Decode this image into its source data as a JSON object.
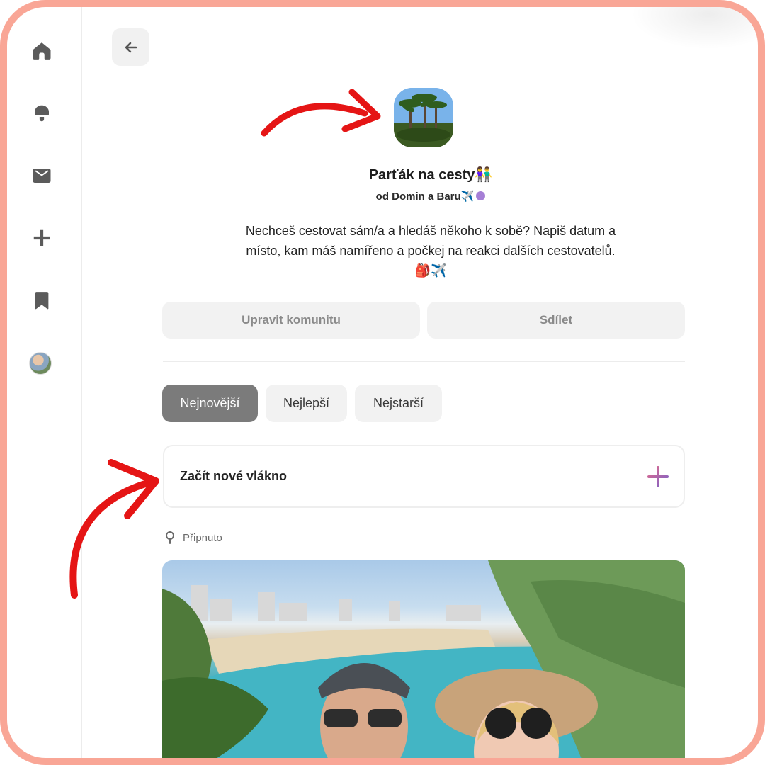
{
  "nav": {
    "items": [
      {
        "icon": "home-icon"
      },
      {
        "icon": "bell-icon"
      },
      {
        "icon": "mail-icon"
      },
      {
        "icon": "plus-icon"
      },
      {
        "icon": "bookmark-icon"
      }
    ]
  },
  "community": {
    "title": "Parťák na cesty👫",
    "by": "od Domin a Baru✈️",
    "description_line1": "Nechceš cestovat sám/a a hledáš někoho k sobě? Napiš datum a",
    "description_line2": "místo, kam máš namířeno a počkej na reakci dalších cestovatelů.",
    "description_line3": "🎒✈️"
  },
  "actions": {
    "edit_label": "Upravit komunitu",
    "share_label": "Sdílet"
  },
  "tabs": [
    {
      "label": "Nejnovější",
      "active": true
    },
    {
      "label": "Nejlepší",
      "active": false
    },
    {
      "label": "Nejstarší",
      "active": false
    }
  ],
  "new_thread": {
    "label": "Začít nové vlákno"
  },
  "pinned": {
    "label": "Připnuto"
  },
  "colors": {
    "frame": "#f9a696",
    "annotation_arrow": "#e51515",
    "active_tab": "#7b7b7b",
    "plus_gradient_start": "#e06a8c",
    "plus_gradient_end": "#7a62c9"
  }
}
